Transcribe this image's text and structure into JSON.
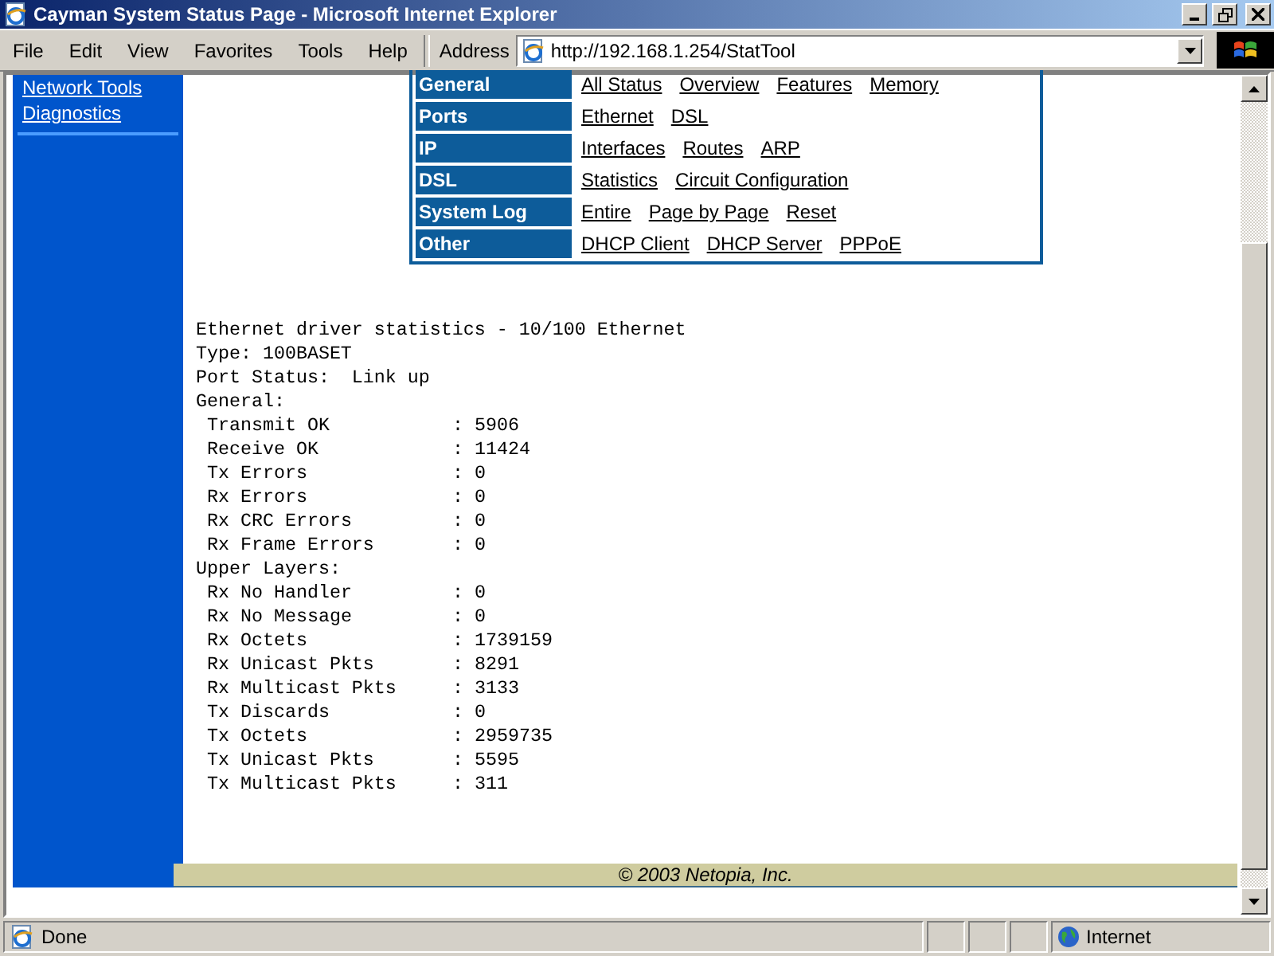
{
  "window": {
    "title": "Cayman System Status Page - Microsoft Internet Explorer"
  },
  "menu": [
    "File",
    "Edit",
    "View",
    "Favorites",
    "Tools",
    "Help"
  ],
  "address": {
    "label": "Address",
    "value": "http://192.168.1.254/StatTool"
  },
  "sidebar": {
    "links": [
      "Network Tools",
      "Diagnostics"
    ]
  },
  "nav": [
    {
      "label": "General",
      "links": [
        "All Status",
        "Overview",
        "Features",
        "Memory"
      ]
    },
    {
      "label": "Ports",
      "links": [
        "Ethernet",
        "DSL"
      ]
    },
    {
      "label": "IP",
      "links": [
        "Interfaces",
        "Routes",
        "ARP"
      ]
    },
    {
      "label": "DSL",
      "links": [
        "Statistics",
        "Circuit Configuration"
      ]
    },
    {
      "label": "System Log",
      "links": [
        "Entire",
        "Page by Page",
        "Reset"
      ]
    },
    {
      "label": "Other",
      "links": [
        "DHCP Client",
        "DHCP Server",
        "PPPoE"
      ]
    }
  ],
  "report": [
    {
      "kind": "heading",
      "text": "Ethernet driver statistics - 10/100 Ethernet"
    },
    {
      "kind": "heading",
      "text": "Type: 100BASET"
    },
    {
      "kind": "heading",
      "text": "Port Status:  Link up"
    },
    {
      "kind": "heading",
      "text": "General:"
    },
    {
      "kind": "stat",
      "label": "Transmit OK",
      "value": ": 5906"
    },
    {
      "kind": "stat",
      "label": "Receive OK",
      "value": ": 11424"
    },
    {
      "kind": "stat",
      "label": "Tx Errors",
      "value": ": 0"
    },
    {
      "kind": "stat",
      "label": "Rx Errors",
      "value": ": 0"
    },
    {
      "kind": "stat",
      "label": "Rx CRC Errors",
      "value": ": 0"
    },
    {
      "kind": "stat",
      "label": "Rx Frame Errors",
      "value": ": 0"
    },
    {
      "kind": "heading",
      "text": "Upper Layers:"
    },
    {
      "kind": "stat",
      "label": "Rx No Handler",
      "value": ": 0"
    },
    {
      "kind": "stat",
      "label": "Rx No Message",
      "value": ": 0"
    },
    {
      "kind": "stat",
      "label": "Rx Octets",
      "value": ": 1739159"
    },
    {
      "kind": "stat",
      "label": "Rx Unicast Pkts",
      "value": ": 8291"
    },
    {
      "kind": "stat",
      "label": "Rx Multicast Pkts",
      "value": ": 3133"
    },
    {
      "kind": "stat",
      "label": "Tx Discards",
      "value": ": 0"
    },
    {
      "kind": "stat",
      "label": "Tx Octets",
      "value": ": 2959735"
    },
    {
      "kind": "stat",
      "label": "Tx Unicast Pkts",
      "value": ": 5595"
    },
    {
      "kind": "stat",
      "label": "Tx Multicast Pkts",
      "value": ": 311"
    }
  ],
  "footer": "© 2003 Netopia, Inc.",
  "status_bar": {
    "text": "Done",
    "zone": "Internet"
  }
}
